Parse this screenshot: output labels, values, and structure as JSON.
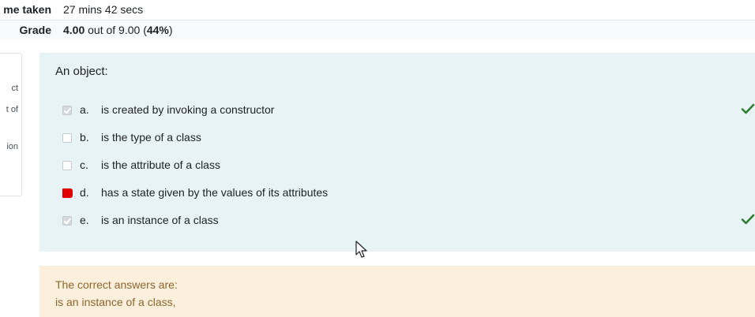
{
  "summary": {
    "time_label": "me taken",
    "time_value": "27 mins 42 secs",
    "grade_label": "Grade",
    "grade_score": "4.00",
    "grade_rest": " out of 9.00 (",
    "grade_percent": "44%",
    "grade_close": ")"
  },
  "infobox": {
    "lines": [
      "ct",
      "t of",
      "ion"
    ]
  },
  "question": {
    "text": "An object:",
    "options": [
      {
        "letter": "a.",
        "text": "is created by invoking a constructor",
        "state": "checked",
        "correct": true
      },
      {
        "letter": "b.",
        "text": "is the type of a class",
        "state": "unchecked",
        "correct": false
      },
      {
        "letter": "c.",
        "text": "is the attribute of a class",
        "state": "unchecked",
        "correct": false
      },
      {
        "letter": "d.",
        "text": "has a state given by the values of its attributes",
        "state": "highlighted",
        "correct": false
      },
      {
        "letter": "e.",
        "text": "is an instance of a class",
        "state": "checked",
        "correct": true
      }
    ]
  },
  "feedback": {
    "line1": "The correct answers are:",
    "line2": "is an instance of a class,"
  },
  "colors": {
    "correct_tick": "#2e7d32",
    "question_bg": "#e7f3f5",
    "feedback_bg": "#fcefdc",
    "highlight_red": "#e00000"
  }
}
